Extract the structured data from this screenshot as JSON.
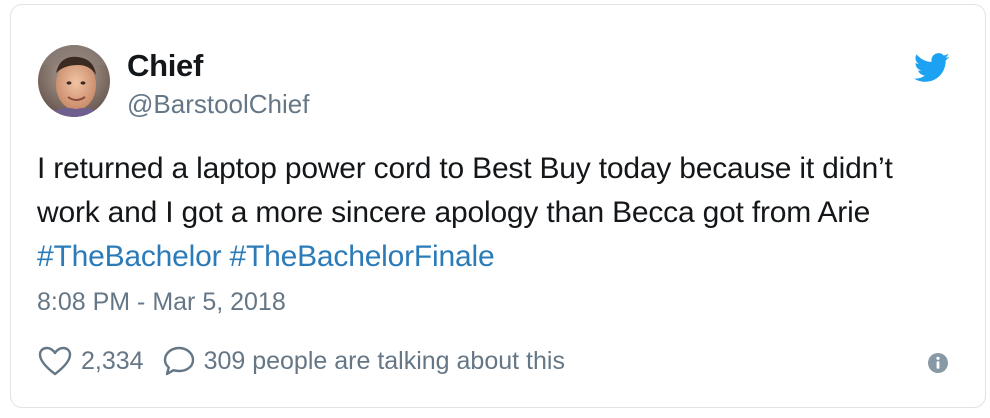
{
  "user": {
    "display_name": "Chief",
    "handle": "@BarstoolChief"
  },
  "tweet": {
    "text": "I returned a laptop power cord to Best Buy today because it didn’t work and I got a more sincere apology than Becca got from Arie ",
    "hashtags": [
      "#TheBachelor",
      "#TheBachelorFinale"
    ],
    "timestamp": "8:08 PM - Mar 5, 2018"
  },
  "actions": {
    "likes": "2,334",
    "talking": "309 people are talking about this"
  },
  "icons": {
    "brand": "twitter-bird-icon",
    "like": "heart-icon",
    "reply": "reply-bubble-icon",
    "info": "info-icon"
  },
  "colors": {
    "brand_blue": "#1da1f2",
    "hashtag_blue": "#2b7bb9",
    "muted_gray": "#657786",
    "text_dark": "#14171a"
  }
}
